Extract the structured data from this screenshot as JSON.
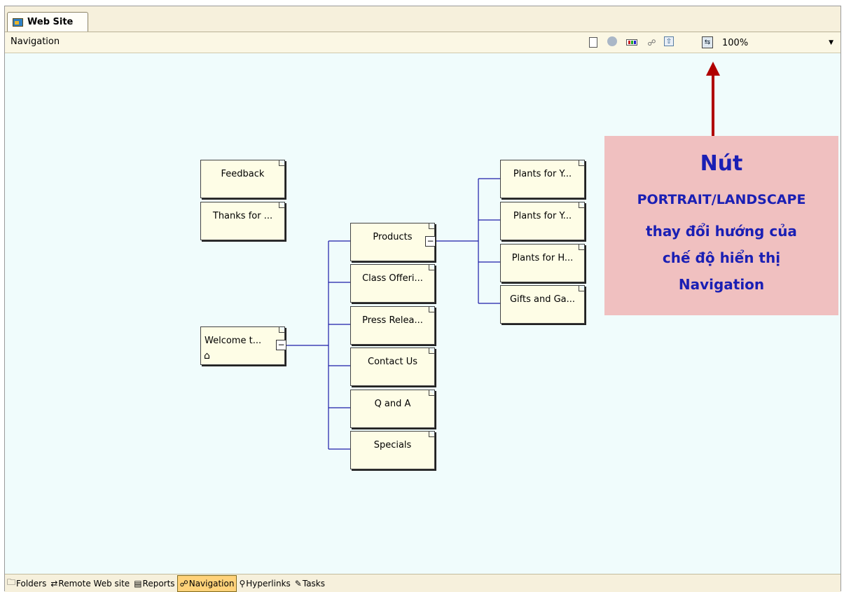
{
  "tab": {
    "label": "Web Site"
  },
  "view": {
    "title": "Navigation",
    "zoom": "100%"
  },
  "toolbar": {
    "icons": [
      "new-page-icon",
      "external-file-icon",
      "color-swatch-icon",
      "tree-icon",
      "up-level-icon",
      "portrait-landscape-icon"
    ]
  },
  "nodes": {
    "feedback": "Feedback",
    "thanks": "Thanks for ...",
    "welcome": "Welcome t...",
    "products": "Products",
    "class": "Class Offeri...",
    "press": "Press Relea...",
    "contact": "Contact Us",
    "qa": "Q and A",
    "specials": "Specials",
    "plants1": "Plants for Y...",
    "plants2": "Plants for Y...",
    "plants3": "Plants for H...",
    "gifts": "Gifts and Ga..."
  },
  "callout": {
    "title": "Nút",
    "line1": "PORTRAIT/LANDSCAPE",
    "line2": "thay đổi hướng của",
    "line3": "chế độ hiển thị",
    "line4": "Navigation"
  },
  "views": {
    "folders": "Folders",
    "remote": "Remote Web site",
    "reports": "Reports",
    "navigation": "Navigation",
    "hyperlinks": "Hyperlinks",
    "tasks": "Tasks"
  },
  "colors": {
    "connector": "#1c1ca8",
    "callout_bg": "#f0c0c0",
    "callout_text": "#1a1fb4",
    "arrow": "#b00000"
  }
}
